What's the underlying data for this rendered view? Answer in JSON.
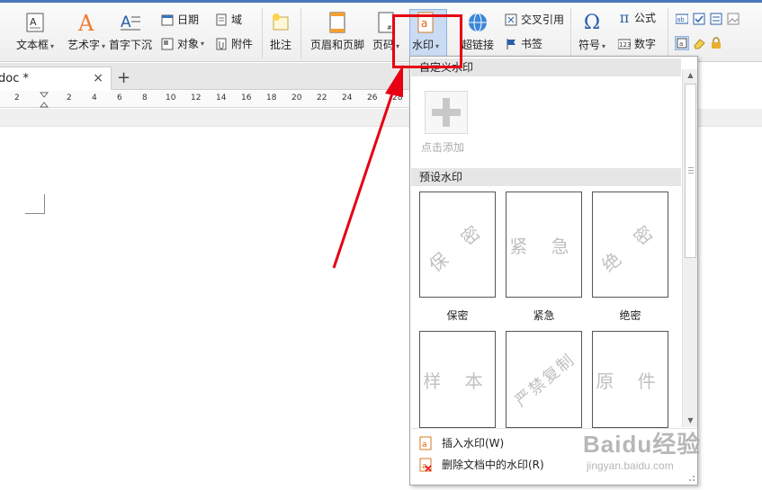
{
  "ribbon": {
    "textbox": "文本框",
    "wordart": "艺术字",
    "dropcap": "首字下沉",
    "date": "日期",
    "field": "域",
    "object": "对象",
    "attachment": "附件",
    "comment": "批注",
    "header_footer": "页眉和页脚",
    "page_number": "页码",
    "watermark": "水印",
    "hyperlink": "超链接",
    "cross_ref": "交叉引用",
    "bookmark": "书签",
    "symbol": "符号",
    "formula": "公式",
    "number": "数字"
  },
  "tabs": {
    "doc_name": "doc *",
    "close": "×",
    "add": "+"
  },
  "ruler": [
    "2",
    "2",
    "4",
    "6",
    "8",
    "10",
    "12",
    "14",
    "16",
    "18",
    "20",
    "22",
    "24",
    "26",
    "28"
  ],
  "watermark_panel": {
    "custom_header": "自定义水印",
    "add_label": "点击添加",
    "preset_header": "预设水印",
    "presets": [
      {
        "text": "保 密",
        "caption": "保密"
      },
      {
        "text": "紧 急",
        "caption": "紧急"
      },
      {
        "text": "绝 密",
        "caption": "绝密"
      },
      {
        "text": "样 本",
        "caption": ""
      },
      {
        "text": "严禁复制",
        "caption": ""
      },
      {
        "text": "原 件",
        "caption": ""
      }
    ],
    "insert_watermark": "插入水印(W)",
    "remove_watermark": "删除文档中的水印(R)"
  },
  "colors": {
    "highlight_box": "#e60012",
    "accent": "#4a78b8"
  },
  "watermark_overlay": {
    "logo": "Baidu经验",
    "site": "jingyan.baidu.com"
  }
}
